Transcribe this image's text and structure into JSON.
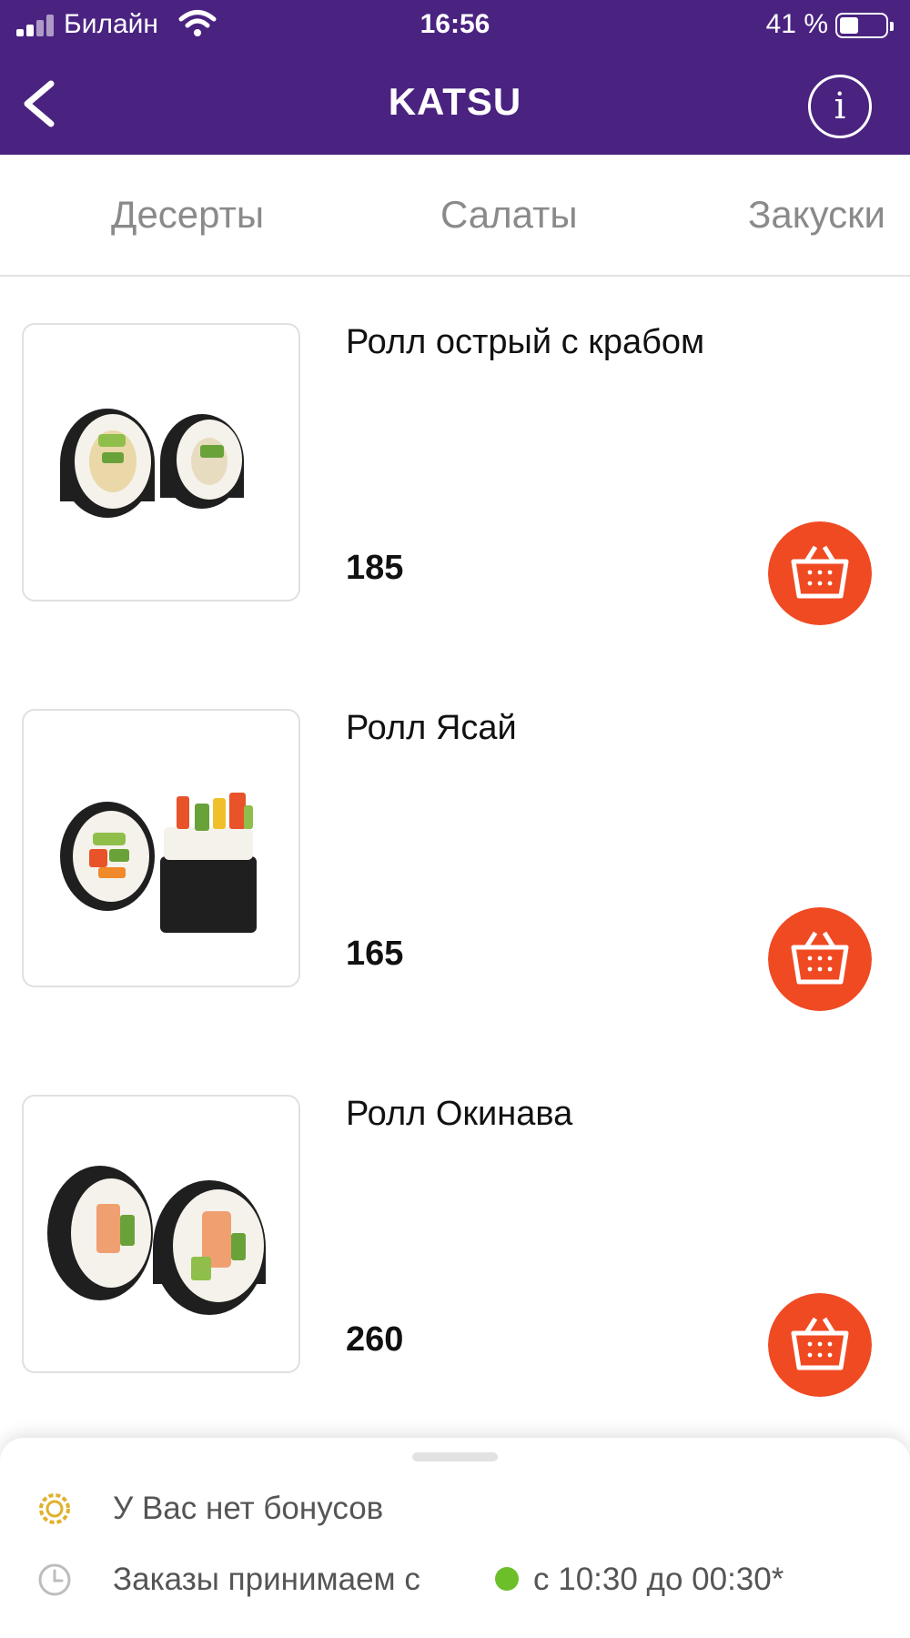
{
  "status_bar": {
    "carrier": "Билайн",
    "time": "16:56",
    "battery_percent": "41 %",
    "battery_level": 0.41
  },
  "header": {
    "title": "KATSU",
    "back_icon": "chevron-left-icon",
    "info_icon": "info-icon",
    "info_glyph": "i"
  },
  "tabs": [
    "Десерты",
    "Салаты",
    "Закуски"
  ],
  "products": [
    {
      "name": "Ролл острый с крабом",
      "price": "185"
    },
    {
      "name": "Ролл Ясай",
      "price": "165"
    },
    {
      "name": "Ролл Окинава",
      "price": "260"
    }
  ],
  "bottom_sheet": {
    "bonus_text": "У Вас нет бонусов",
    "hours_label": "Заказы принимаем с",
    "hours_value": "с 10:30 до 00:30*"
  },
  "colors": {
    "header_bg": "#4a2381",
    "cart_button": "#f04a23",
    "status_open": "#6dbf2a",
    "bonus_icon": "#e0b12c"
  }
}
